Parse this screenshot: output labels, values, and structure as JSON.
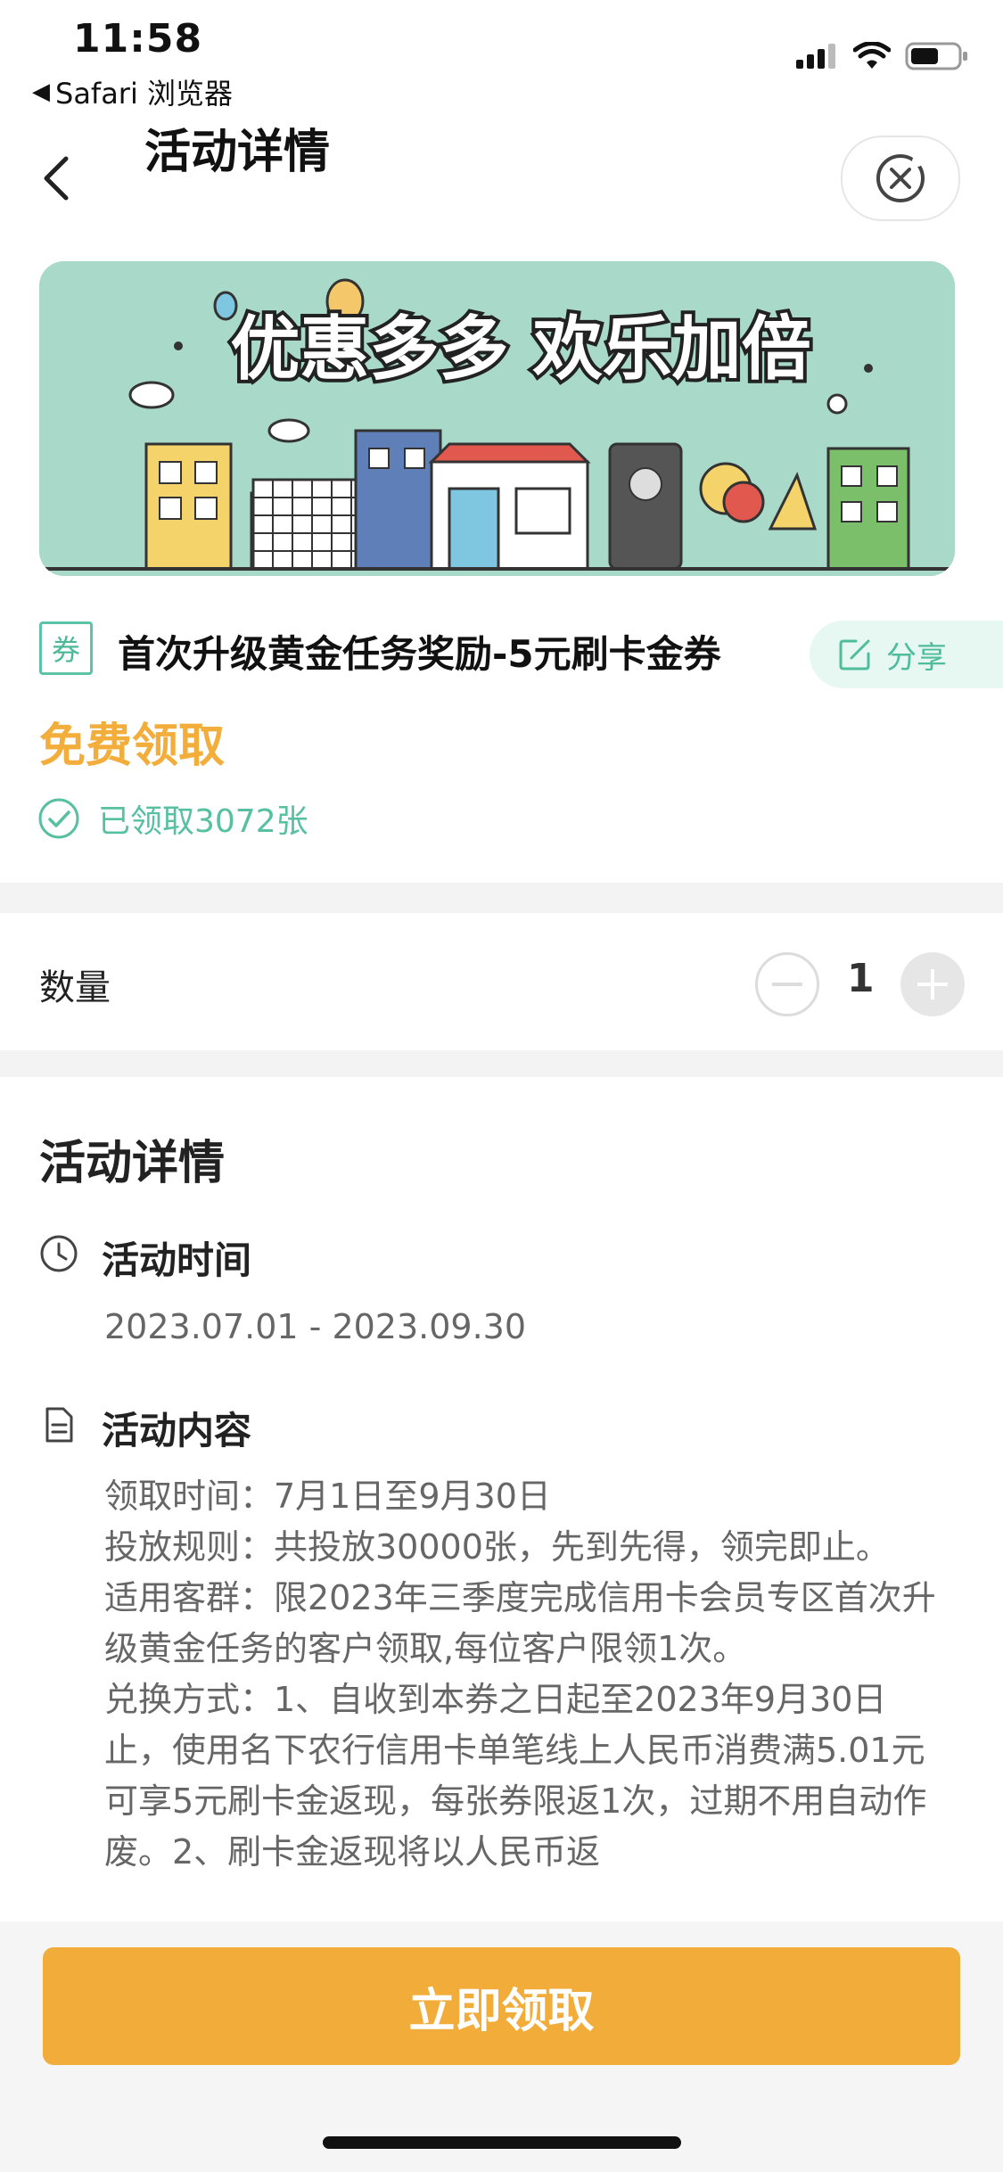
{
  "status_bar": {
    "time": "11:58",
    "back_app_label": "Safari 浏览器",
    "icons": [
      "signal-icon",
      "wifi-icon",
      "battery-icon"
    ]
  },
  "nav": {
    "title": "活动详情",
    "back_icon": "chevron-left-icon",
    "close_icon": "close-circle-icon"
  },
  "banner": {
    "headline": "优惠多多 欢乐加倍"
  },
  "coupon": {
    "tag": "券",
    "title": "首次升级黄金任务奖励-5元刷卡金券",
    "share_label": "分享",
    "price_label": "免费领取",
    "claimed_text": "已领取3072张"
  },
  "quantity": {
    "label": "数量",
    "value": "1"
  },
  "details": {
    "title": "活动详情",
    "time_heading": "活动时间",
    "date_range": "2023.07.01 - 2023.09.30",
    "content_heading": "活动内容",
    "content_lines": [
      "领取时间：7月1日至9月30日",
      "投放规则：共投放30000张，先到先得，领完即止。",
      "适用客群：限2023年三季度完成信用卡会员专区首次升级黄金任务的客户领取,每位客户限领1次。",
      "兑换方式：1、自收到本券之日起至2023年9月30日止，使用名下农行信用卡单笔线上人民币消费满5.01元可享5元刷卡金返现，每张券限返1次，过期不用自动作废。2、刷卡金返现将以人民币返"
    ]
  },
  "cta": {
    "label": "立即领取"
  },
  "colors": {
    "accent_orange": "#f2ac39",
    "accent_green": "#56c0a0"
  }
}
